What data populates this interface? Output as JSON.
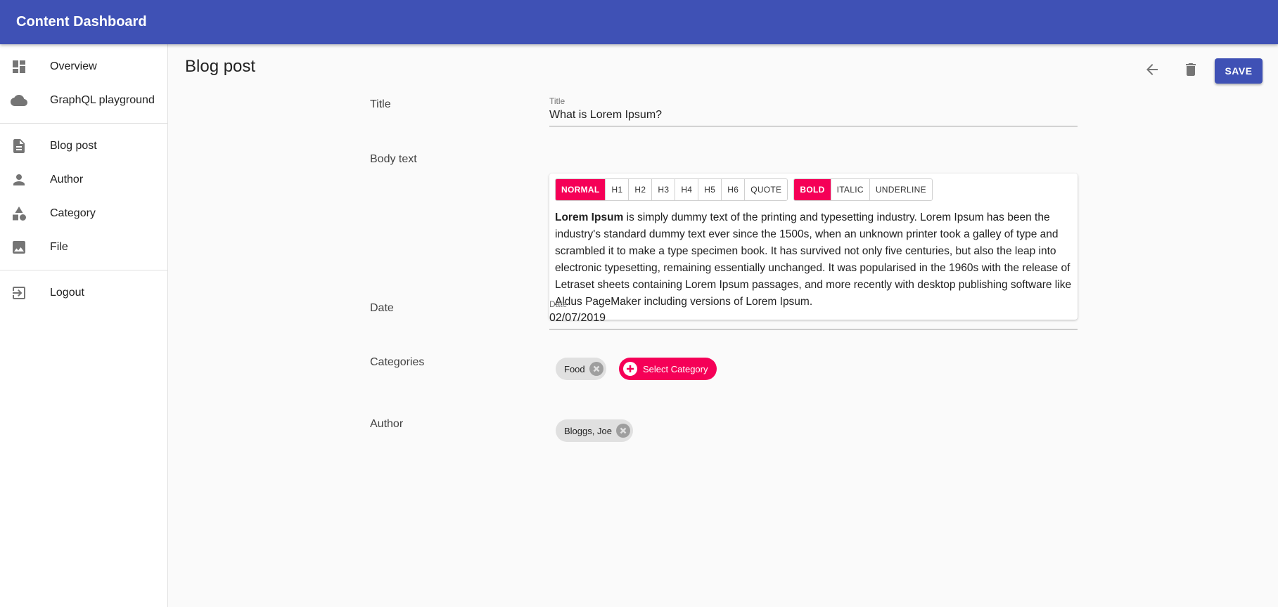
{
  "app": {
    "title": "Content Dashboard"
  },
  "sidebar": {
    "groups": [
      [
        {
          "label": "Overview",
          "icon": "dashboard-icon"
        },
        {
          "label": "GraphQL playground",
          "icon": "cloud-icon"
        }
      ],
      [
        {
          "label": "Blog post",
          "icon": "document-icon"
        },
        {
          "label": "Author",
          "icon": "person-icon"
        },
        {
          "label": "Category",
          "icon": "category-icon"
        },
        {
          "label": "File",
          "icon": "image-icon"
        }
      ],
      [
        {
          "label": "Logout",
          "icon": "logout-icon"
        }
      ]
    ]
  },
  "header": {
    "title": "Blog post",
    "back_icon": "arrow-back-icon",
    "delete_icon": "trash-icon",
    "save_label": "SAVE"
  },
  "form": {
    "title": {
      "label": "Title",
      "field_label": "Title",
      "value": "What is Lorem Ipsum?"
    },
    "body": {
      "label": "Body text",
      "block_buttons": [
        "NORMAL",
        "H1",
        "H2",
        "H3",
        "H4",
        "H5",
        "H6",
        "QUOTE"
      ],
      "active_block": "NORMAL",
      "inline_buttons": [
        "BOLD",
        "ITALIC",
        "UNDERLINE"
      ],
      "active_inline": "BOLD",
      "bold_text": "Lorem Ipsum",
      "text": " is simply dummy text of the printing and typesetting industry. Lorem Ipsum has been the industry's standard dummy text ever since the 1500s, when an unknown printer took a galley of type and scrambled it to make a type specimen book. It has survived not only five centuries, but also the leap into electronic typesetting, remaining essentially unchanged. It was popularised in the 1960s with the release of Letraset sheets containing Lorem Ipsum passages, and more recently with desktop publishing software like Aldus PageMaker including versions of Lorem Ipsum."
    },
    "date": {
      "label": "Date",
      "field_label": "Date",
      "value": "02/07/2019"
    },
    "categories": {
      "label": "Categories",
      "chips": [
        "Food"
      ],
      "select_label": "Select Category"
    },
    "author": {
      "label": "Author",
      "chips": [
        "Bloggs, Joe"
      ]
    }
  },
  "colors": {
    "primary": "#3f51b5",
    "accent": "#f50057"
  }
}
